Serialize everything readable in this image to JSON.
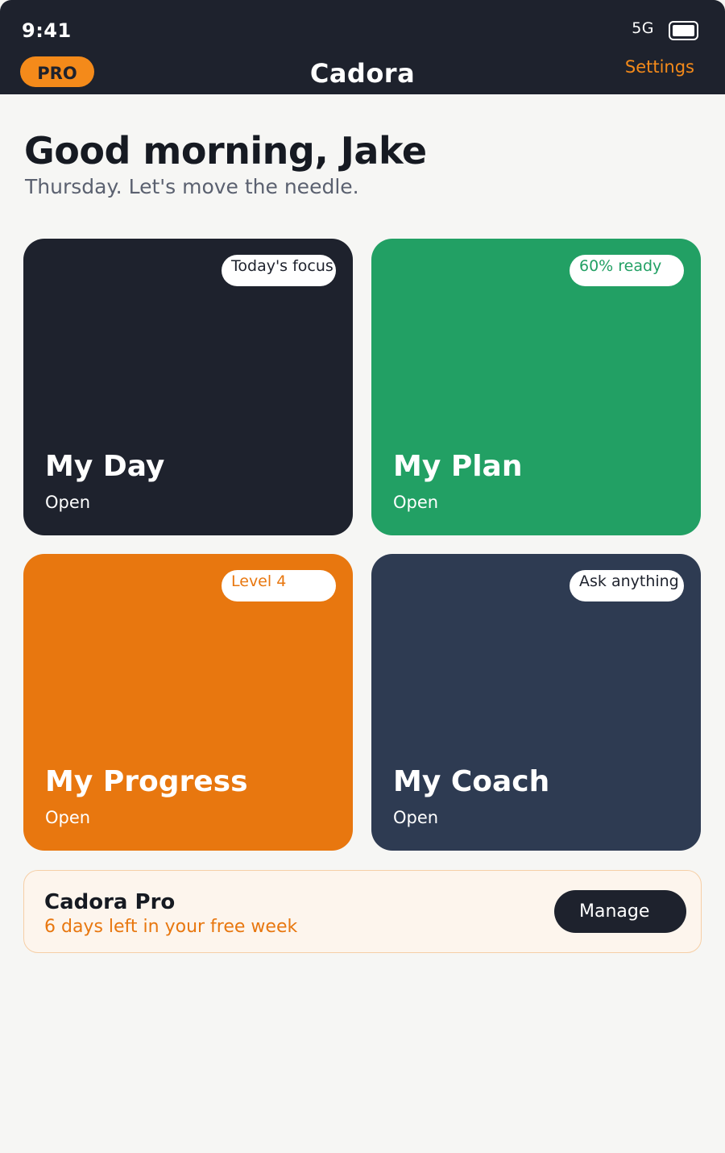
{
  "status_bar": {
    "time": "9:41",
    "network": "5G",
    "battery_icon": "battery-full-icon"
  },
  "header": {
    "badge": "PRO",
    "title": "Cadora",
    "settings_label": "Settings"
  },
  "greeting": {
    "title": "Good morning, Jake",
    "subtitle": "Thursday. Let's move the needle."
  },
  "cards": [
    {
      "title": "My Day",
      "action": "Open",
      "badge": "Today's focus",
      "color": "#1e222d"
    },
    {
      "title": "My Plan",
      "action": "Open",
      "badge": "60% ready",
      "color": "#22a064"
    },
    {
      "title": "My Progress",
      "action": "Open",
      "badge": "Level 4",
      "color": "#e8770f"
    },
    {
      "title": "My Coach",
      "action": "Open",
      "badge": "Ask anything",
      "color": "#2e3b52"
    }
  ],
  "pro_banner": {
    "title": "Cadora Pro",
    "subtitle": "6 days left in your free week",
    "button_label": "Manage"
  },
  "colors": {
    "accent": "#f48a1a",
    "dark": "#1e222d",
    "background": "#f6f6f4"
  }
}
